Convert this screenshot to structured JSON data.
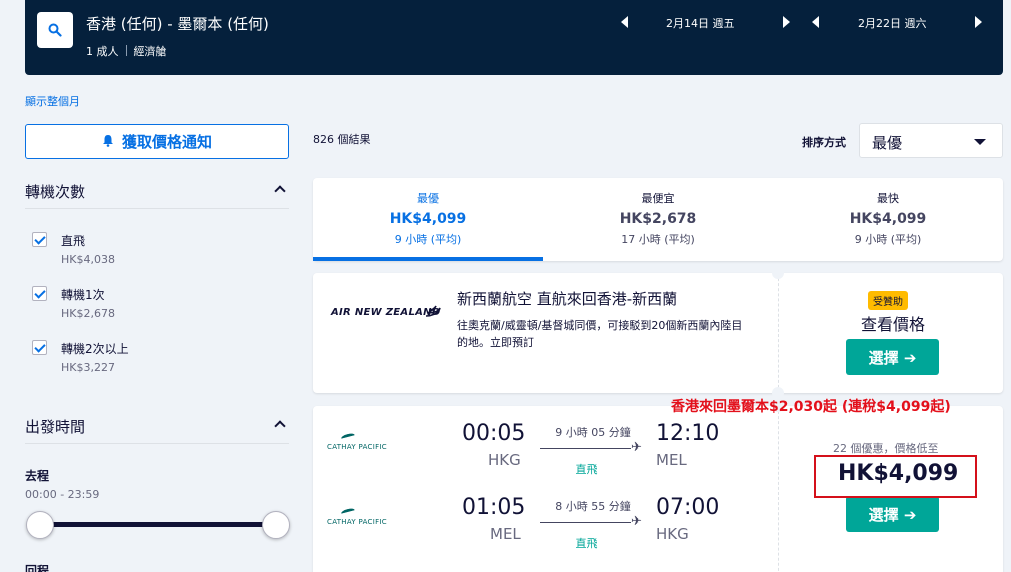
{
  "header": {
    "route": "香港 (任何) - 墨爾本 (任何)",
    "passengers": "1 成人",
    "cabin": "經濟艙",
    "depart_date": "2月14日 週五",
    "return_date": "2月22日 週六"
  },
  "show_month_link": "顯示整個月",
  "sidebar": {
    "alert_button": "獲取價格通知",
    "stops_title": "轉機次數",
    "stops": [
      {
        "label": "直飛",
        "price": "HK$4,038",
        "checked": true
      },
      {
        "label": "轉機1次",
        "price": "HK$2,678",
        "checked": true
      },
      {
        "label": "轉機2次以上",
        "price": "HK$3,227",
        "checked": true
      }
    ],
    "departure_title": "出發時間",
    "outbound_label": "去程",
    "outbound_range": "00:00 - 23:59",
    "next_label": "回程"
  },
  "results": {
    "count": "826 個結果",
    "sort_label": "排序方式",
    "sort_value": "最優"
  },
  "tabs": [
    {
      "name": "最優",
      "price": "HK$4,099",
      "time": "9 小時 (平均)",
      "active": true
    },
    {
      "name": "最便宜",
      "price": "HK$2,678",
      "time": "17 小時 (平均)",
      "active": false
    },
    {
      "name": "最快",
      "price": "HK$4,099",
      "time": "9 小時 (平均)",
      "active": false
    }
  ],
  "ad": {
    "logo": "AIR NEW ZEALAND",
    "title": "新西蘭航空 直航來回香港-新西蘭",
    "description": "往奧克蘭/威靈頓/基督城同價，可接駁到20個新西蘭內陸目的地。立即預訂",
    "sponsor_badge": "受贊助",
    "view_price": "查看價格",
    "button": "選擇 ➔"
  },
  "flight": {
    "airline": "CATHAY PACIFIC",
    "legs": [
      {
        "dep_time": "00:05",
        "dep_airport": "HKG",
        "duration": "9 小時 05 分鐘",
        "stops": "直飛",
        "arr_time": "12:10",
        "arr_airport": "MEL"
      },
      {
        "dep_time": "01:05",
        "dep_airport": "MEL",
        "duration": "8 小時 55 分鐘",
        "stops": "直飛",
        "arr_time": "07:00",
        "arr_airport": "HKG"
      }
    ],
    "deals": "22 個優惠，價格低至",
    "price": "HK$4,099",
    "button": "選擇 ➔"
  },
  "annotation": "香港來回墨爾本$2,030起 (連稅$4,099起)",
  "colors": {
    "header_bg": "#05203c",
    "accent": "#0770e3",
    "select_button": "#00a698",
    "sponsor_badge": "#ffbb00",
    "annotation": "#e3101b"
  }
}
